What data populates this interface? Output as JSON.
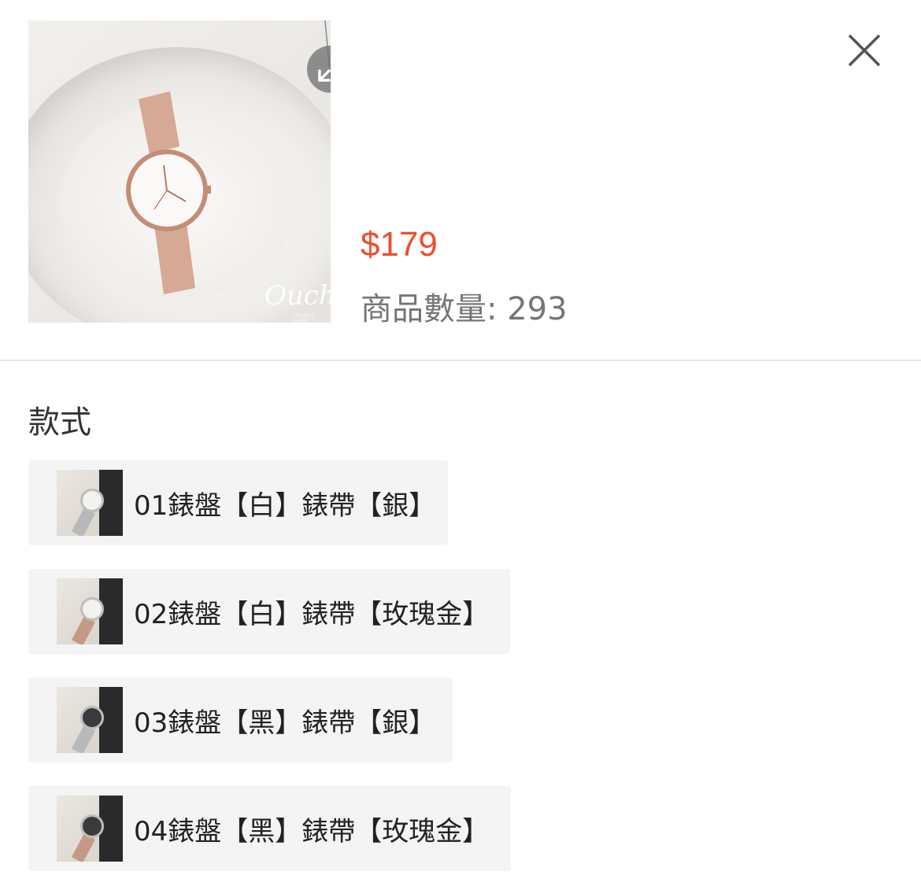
{
  "header": {
    "price": "$179",
    "stock_label": "商品數量:",
    "stock_value": "293",
    "watermark": "Ouch",
    "watermark_sub": "SELECT SHOP"
  },
  "icons": {
    "expand": "expand-arrows-icon",
    "close": "close-icon"
  },
  "variations": {
    "title": "款式",
    "options": [
      {
        "label": "01錶盤【白】錶帶【銀】",
        "dial": "#f4f2ef",
        "strap": "#b9b9bc"
      },
      {
        "label": "02錶盤【白】錶帶【玫瑰金】",
        "dial": "#f4f2ef",
        "strap": "#c49a86"
      },
      {
        "label": "03錶盤【黑】錶帶【銀】",
        "dial": "#3a3a3c",
        "strap": "#b9b9bc"
      },
      {
        "label": "04錶盤【黑】錶帶【玫瑰金】",
        "dial": "#3a3a3c",
        "strap": "#c49a86"
      }
    ]
  },
  "colors": {
    "price": "#ee4d2d",
    "option_bg": "#f4f4f4",
    "divider": "#e8e8e8"
  }
}
